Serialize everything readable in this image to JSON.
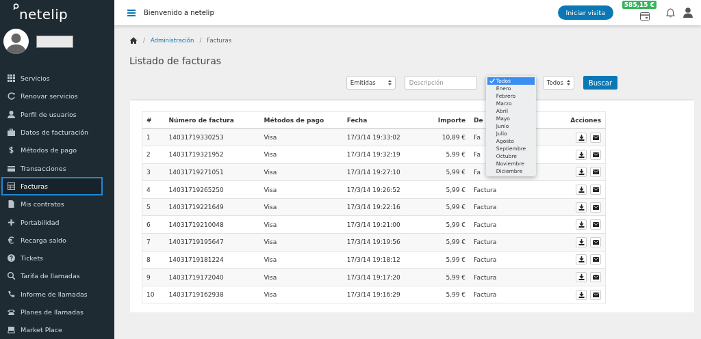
{
  "sidebar": {
    "logo": "netelip",
    "items": [
      {
        "label": "Servicios",
        "selected": false
      },
      {
        "label": "Renovar servicios",
        "selected": false
      },
      {
        "label": "Perfil de usuarios",
        "selected": false
      },
      {
        "label": "Datos de facturación",
        "selected": false
      },
      {
        "label": "Métodos de pago",
        "selected": false
      },
      {
        "label": "Transacciones",
        "selected": false
      },
      {
        "label": "Facturas",
        "selected": true
      },
      {
        "label": "Mis contratos",
        "selected": false
      },
      {
        "label": "Portabilidad",
        "selected": false
      },
      {
        "label": "Recarga saldo",
        "selected": false
      },
      {
        "label": "Tickets",
        "selected": false
      },
      {
        "label": "Tarifa de llamadas",
        "selected": false
      },
      {
        "label": "Informe de llamadas",
        "selected": false
      },
      {
        "label": "Planes de llamadas",
        "selected": false
      },
      {
        "label": "Market Place",
        "selected": false
      }
    ]
  },
  "topbar": {
    "welcome": "Bienvenido a netelip",
    "visit_button": "Iniciar visita",
    "balance": "585,15 €"
  },
  "breadcrumb": [
    {
      "label": "/",
      "kind": "separator"
    },
    {
      "label": "Administración",
      "kind": "link"
    },
    {
      "label": "/",
      "kind": "separator"
    },
    {
      "label": "Facturas",
      "kind": "current"
    }
  ],
  "title": "Listado de facturas",
  "filters": {
    "type_select": "Emitidas",
    "description": {
      "placeholder": "Descripción"
    },
    "year_select": "Todos",
    "search_button": "Buscar",
    "month_menu": [
      {
        "label": "Todos",
        "selected": true
      },
      {
        "label": "Enero",
        "selected": false
      },
      {
        "label": "Febrero",
        "selected": false
      },
      {
        "label": "Marzo",
        "selected": false
      },
      {
        "label": "Abril",
        "selected": false
      },
      {
        "label": "Mayo",
        "selected": false
      },
      {
        "label": "Junio",
        "selected": false
      },
      {
        "label": "Julio",
        "selected": false
      },
      {
        "label": "Agosto",
        "selected": false
      },
      {
        "label": "Septiembre",
        "selected": false
      },
      {
        "label": "Octubre",
        "selected": false
      },
      {
        "label": "Noviembre",
        "selected": false
      },
      {
        "label": "Diciembre",
        "selected": false
      }
    ]
  },
  "table": {
    "columns": [
      "#",
      "Número de factura",
      "Métodos de pago",
      "Fecha",
      "Importe",
      "De",
      "Acciones"
    ],
    "rows": [
      [
        "1",
        "14031719330253",
        "Visa",
        "17/3/14 19:33:02",
        "10,89 €",
        "Fa"
      ],
      [
        "2",
        "14031719321952",
        "Visa",
        "17/3/14 19:32:19",
        "5,99 €",
        "Fa"
      ],
      [
        "3",
        "14031719271051",
        "Visa",
        "17/3/14 19:27:10",
        "5,99 €",
        "Fa"
      ],
      [
        "4",
        "14031719265250",
        "Visa",
        "17/3/14 19:26:52",
        "5,99 €",
        "Factura"
      ],
      [
        "5",
        "14031719221649",
        "Visa",
        "17/3/14 19:22:16",
        "5,99 €",
        "Factura"
      ],
      [
        "6",
        "14031719210048",
        "Visa",
        "17/3/14 19:21:00",
        "5,99 €",
        "Factura"
      ],
      [
        "7",
        "14031719195647",
        "Visa",
        "17/3/14 19:19:56",
        "5,99 €",
        "Factura"
      ],
      [
        "8",
        "14031719181224",
        "Visa",
        "17/3/14 19:18:12",
        "5,99 €",
        "Factura"
      ],
      [
        "9",
        "14031719172040",
        "Visa",
        "17/3/14 19:17:20",
        "5,99 €",
        "Factura"
      ],
      [
        "10",
        "14031719162938",
        "Visa",
        "17/3/14 19:16:29",
        "5,99 €",
        "Factura"
      ]
    ]
  }
}
